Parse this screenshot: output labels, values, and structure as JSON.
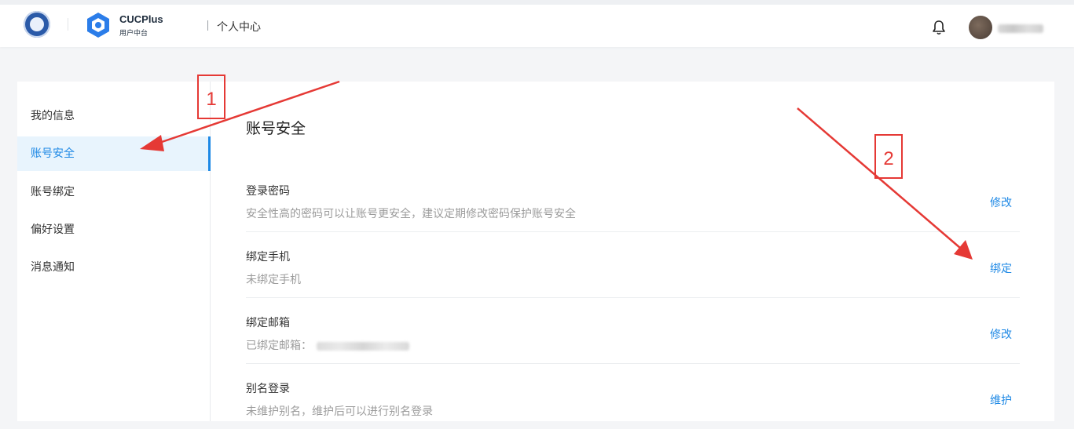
{
  "header": {
    "brand_name": "CUCPlus",
    "brand_sub": "用户中台",
    "page_title": "个人中心",
    "icons": {
      "notifications": "bell-icon",
      "university_logo": "university-seal-icon",
      "brand": "cucplus-logo-icon"
    }
  },
  "sidebar": {
    "items": [
      {
        "label": "我的信息",
        "active": false
      },
      {
        "label": "账号安全",
        "active": true
      },
      {
        "label": "账号绑定",
        "active": false
      },
      {
        "label": "偏好设置",
        "active": false
      },
      {
        "label": "消息通知",
        "active": false
      }
    ]
  },
  "main": {
    "title": "账号安全",
    "rows": [
      {
        "title": "登录密码",
        "desc": "安全性高的密码可以让账号更安全，建议定期修改密码保护账号安全",
        "action": "修改"
      },
      {
        "title": "绑定手机",
        "desc": "未绑定手机",
        "action": "绑定"
      },
      {
        "title": "绑定邮箱",
        "desc": "已绑定邮箱：",
        "action": "修改"
      },
      {
        "title": "别名登录",
        "desc": "未维护别名，维护后可以进行别名登录",
        "action": "维护"
      }
    ]
  },
  "annotations": [
    {
      "label": "1"
    },
    {
      "label": "2"
    }
  ],
  "colors": {
    "accent": "#1d88e5",
    "active_bg": "#e8f4fd",
    "annotation": "#e53935"
  }
}
